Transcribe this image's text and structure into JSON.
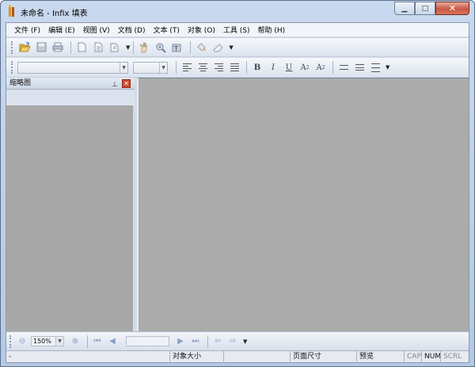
{
  "window": {
    "title": "未命名 - Infix 填表"
  },
  "menu": [
    "文件 (F)",
    "编辑 (E)",
    "视图 (V)",
    "文档 (D)",
    "文本 (T)",
    "对象 (O)",
    "工具 (S)",
    "帮助 (H)"
  ],
  "format_bar": {
    "font_value": "",
    "size_value": "",
    "superscript": "A",
    "sup_mark": "2",
    "subscript": "A",
    "sub_mark": "2",
    "bold": "B",
    "italic": "I",
    "underline": "U"
  },
  "side_panel": {
    "title": "缩略图"
  },
  "navbar": {
    "zoom": "150%",
    "page": ""
  },
  "status": {
    "left": "-",
    "object_size": "对象大小",
    "page_size": "页面尺寸",
    "preview": "预览",
    "cap": "CAP",
    "num": "NUM",
    "scrl": "SCRL"
  },
  "colors": {
    "canvas": "#ababab",
    "chrome": "#d4dbe8",
    "close_button": "#c75a45"
  }
}
